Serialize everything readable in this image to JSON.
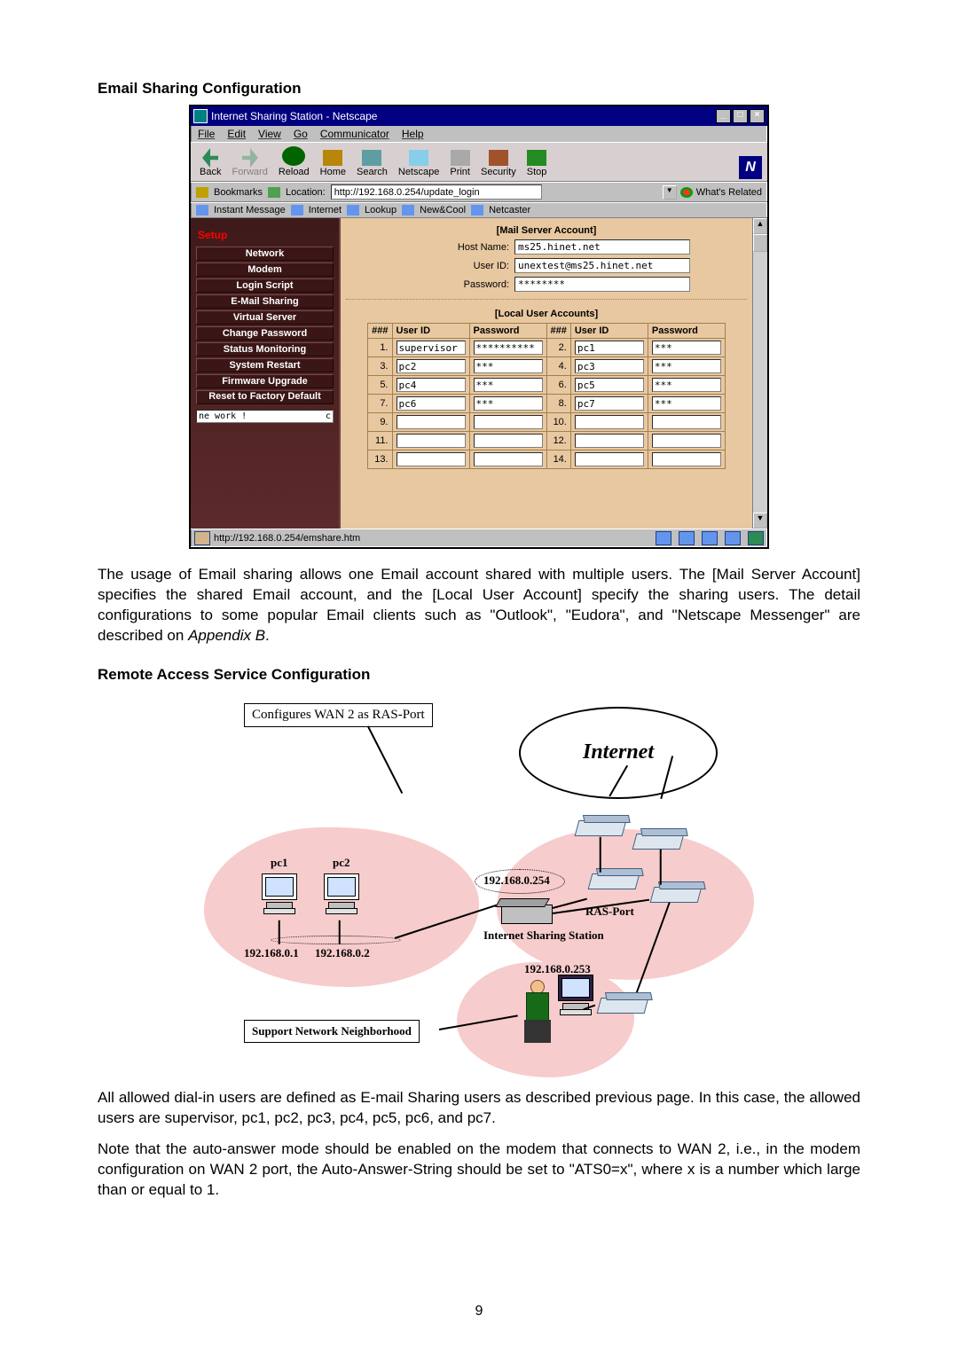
{
  "heading1": "Email Sharing Configuration",
  "netscape": {
    "title": "Internet Sharing Station - Netscape",
    "win_btns": {
      "min": "_",
      "max": "□",
      "close": "×"
    },
    "menus": [
      "File",
      "Edit",
      "View",
      "Go",
      "Communicator",
      "Help"
    ],
    "toolbar": {
      "back": "Back",
      "forward": "Forward",
      "reload": "Reload",
      "home": "Home",
      "search": "Search",
      "netscape": "Netscape",
      "print": "Print",
      "security": "Security",
      "stop": "Stop",
      "big_n": "N"
    },
    "addrbar": {
      "bookmarks": "Bookmarks",
      "location_label": "Location:",
      "location_value": "http://192.168.0.254/update_login",
      "whats_related": "What's Related"
    },
    "linksbar": [
      "Instant Message",
      "Internet",
      "Lookup",
      "New&Cool",
      "Netcaster"
    ],
    "sidebar": {
      "head": "Setup",
      "items": [
        "Network",
        "Modem",
        "Login Script",
        "E-Mail Sharing",
        "Virtual Server",
        "Change Password",
        "Status Monitoring",
        "System Restart",
        "Firmware Upgrade",
        "Reset to Factory Default"
      ],
      "statusbox": {
        "text": "ne work !",
        "right": "c"
      }
    },
    "main": {
      "mail_server_title": "[Mail Server Account]",
      "host_name_label": "Host Name:",
      "host_name_value": "ms25.hinet.net",
      "user_id_label": "User ID:",
      "user_id_value": "unextest@ms25.hinet.net",
      "password_label": "Password:",
      "password_value": "********",
      "local_title": "[Local User Accounts]",
      "cols": {
        "hash": "###",
        "uid": "User ID",
        "pwd": "Password"
      },
      "rows": [
        {
          "n": 1,
          "uid": "supervisor",
          "pwd": "**********"
        },
        {
          "n": 2,
          "uid": "pc1",
          "pwd": "***"
        },
        {
          "n": 3,
          "uid": "pc2",
          "pwd": "***"
        },
        {
          "n": 4,
          "uid": "pc3",
          "pwd": "***"
        },
        {
          "n": 5,
          "uid": "pc4",
          "pwd": "***"
        },
        {
          "n": 6,
          "uid": "pc5",
          "pwd": "***"
        },
        {
          "n": 7,
          "uid": "pc6",
          "pwd": "***"
        },
        {
          "n": 8,
          "uid": "pc7",
          "pwd": "***"
        },
        {
          "n": 9,
          "uid": "",
          "pwd": ""
        },
        {
          "n": 10,
          "uid": "",
          "pwd": ""
        },
        {
          "n": 11,
          "uid": "",
          "pwd": ""
        },
        {
          "n": 12,
          "uid": "",
          "pwd": ""
        },
        {
          "n": 13,
          "uid": "",
          "pwd": ""
        },
        {
          "n": 14,
          "uid": "",
          "pwd": ""
        }
      ]
    },
    "statusbar": {
      "url": "http://192.168.0.254/emshare.htm"
    }
  },
  "para1_a": "The usage of Email sharing allows one Email account shared with multiple users. The [Mail Server Account] specifies the shared Email account, and the [Local User Account] specify the sharing users. The detail configurations to some popular Email clients such as \"Outlook\", \"Eudora\", and \"Netscape Messenger\" are described on ",
  "para1_b": "Appendix B",
  "para1_c": ".",
  "heading2": "Remote Access Service Configuration",
  "diagram": {
    "config_box": "Configures WAN 2 as RAS-Port",
    "internet": "Internet",
    "pc1": "pc1",
    "pc2": "pc2",
    "ip_pc1": "192.168.0.1",
    "ip_pc2": "192.168.0.2",
    "ip_iss": "192.168.0.254",
    "ras_port": "RAS-Port",
    "iss_label": "Internet Sharing Station",
    "ip_ras": "192.168.0.253",
    "support_box": "Support Network Neighborhood"
  },
  "para2": "All allowed dial-in users are defined as E-mail Sharing users as described previous page. In this case, the allowed users are supervisor, pc1, pc2, pc3, pc4, pc5, pc6, and pc7.",
  "para3": "Note that the auto-answer mode should be enabled on the modem that connects to WAN 2, i.e., in the modem configuration on WAN 2 port, the Auto-Answer-String should be set to \"ATS0=x\", where x is a number which large than or equal to 1.",
  "page_number": "9"
}
